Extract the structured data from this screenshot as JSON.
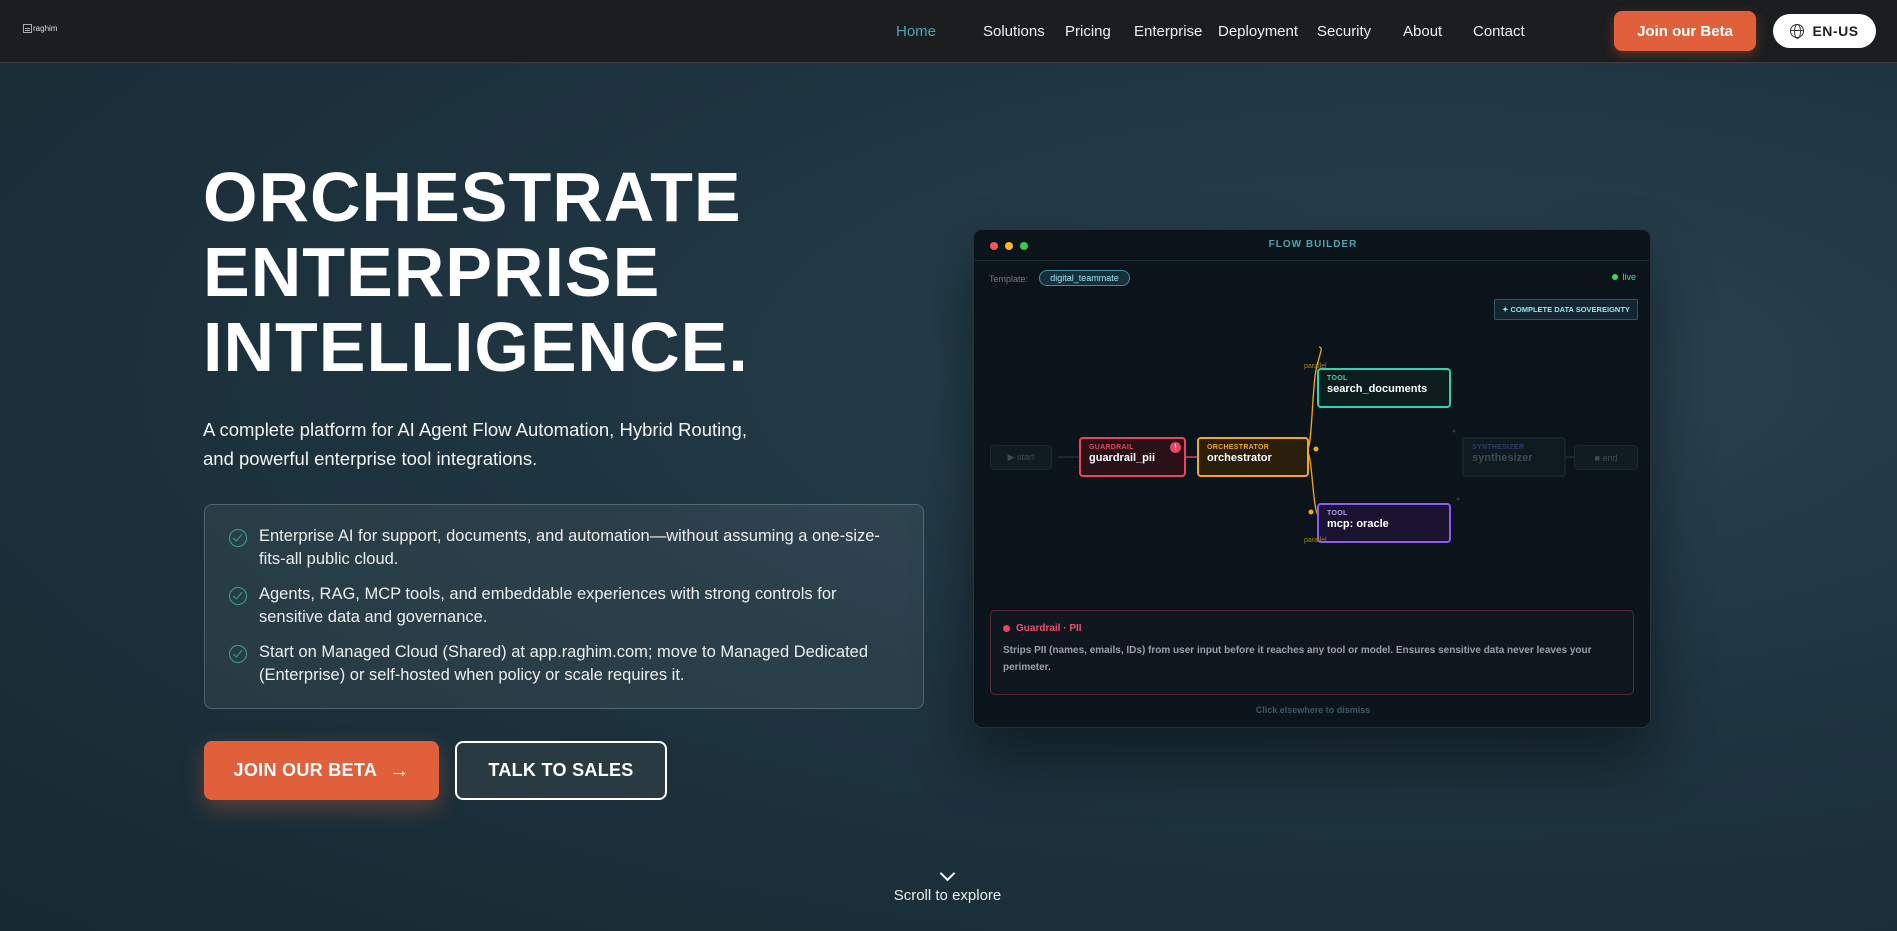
{
  "nav": {
    "logo_text": "raghim",
    "links": [
      "Home",
      "Solutions",
      "Pricing",
      "Enterprise",
      "Deployment",
      "Security",
      "About",
      "Contact"
    ],
    "cta": "Join our Beta",
    "lang": "EN-US"
  },
  "hero": {
    "title_lines": [
      "ORCHESTRATE",
      "ENTERPRISE",
      "INTELLIGENCE."
    ],
    "subtitle_1": "A complete platform for AI Agent Flow Automation, Hybrid Routing,",
    "subtitle_2": "and powerful enterprise tool integrations.",
    "features": [
      "Enterprise AI for support, documents, and automation—without assuming a one-size-fits-all public cloud.",
      "Agents, RAG, MCP tools, and embeddable experiences with strong controls for sensitive data and governance.",
      "Start on Managed Cloud (Shared) at app.raghim.com; move to Managed Dedicated (Enterprise) or self-hosted when policy or scale requires it."
    ],
    "primary_cta": "JOIN OUR BETA",
    "secondary_cta": "TALK TO SALES",
    "scroll_hint": "Scroll to explore"
  },
  "flow_builder": {
    "title": "FLOW BUILDER",
    "template_label": "Template:",
    "template_value": "digital_teammate",
    "status": "live",
    "sovereignty_badge": "✦ COMPLETE DATA SOVEREIGNTY",
    "nodes": {
      "start": "▶ start",
      "guardrail": {
        "kind": "GUARDRAIL",
        "name": "guardrail_pii",
        "badge": "!"
      },
      "orchestrator": {
        "kind": "ORCHESTRATOR",
        "name": "orchestrator"
      },
      "tool_search": {
        "kind": "TOOL",
        "name": "search_documents"
      },
      "tool_oracle": {
        "kind": "TOOL",
        "name": "mcp: oracle"
      },
      "synthesizer": {
        "kind": "SYNTHESIZER",
        "name": "synthesizer"
      },
      "end": "■ end"
    },
    "edge_labels": [
      "parallel",
      "parallel"
    ],
    "info_panel": {
      "title": "Guardrail · PII",
      "body": "Strips PII (names, emails, IDs) from user input before it reaches any tool or model. Ensures sensitive data never leaves your perimeter."
    },
    "dismiss_hint": "Click elsewhere to dismiss",
    "colors": {
      "guardrail": "#e64660",
      "orchestrator": "#f2a81a",
      "tool_search": "#2fd3b0",
      "tool_oracle": "#8b5cf6",
      "accent": "#e0603c"
    }
  }
}
